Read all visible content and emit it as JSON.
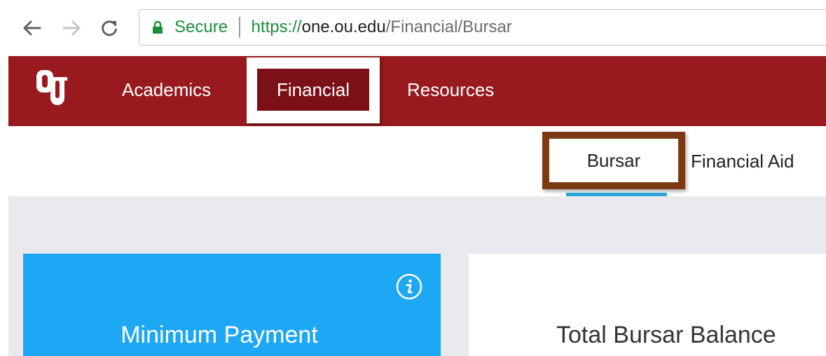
{
  "browser": {
    "secure_label": "Secure",
    "url_scheme": "https://",
    "url_host": "one.ou.edu",
    "url_path": "/Financial/Bursar"
  },
  "nav": {
    "logo_icon": "ou-logo",
    "items": [
      {
        "label": "Academics"
      },
      {
        "label": "Financial",
        "active": true
      },
      {
        "label": "Resources"
      }
    ]
  },
  "subnav": {
    "items": [
      {
        "label": "Bursar",
        "active": true
      },
      {
        "label": "Financial Aid"
      }
    ]
  },
  "cards": {
    "minimum_payment": {
      "title": "Minimum Payment",
      "icon": "info-icon"
    },
    "total_balance": {
      "title": "Total Bursar Balance"
    }
  },
  "colors": {
    "nav_red": "#981a1e",
    "active_nav": "#7b1116",
    "highlight_brown": "#7b3a13",
    "tab_underline": "#2ea7e0",
    "card_blue": "#1ea7f5",
    "secure_green": "#1a8f3c"
  }
}
